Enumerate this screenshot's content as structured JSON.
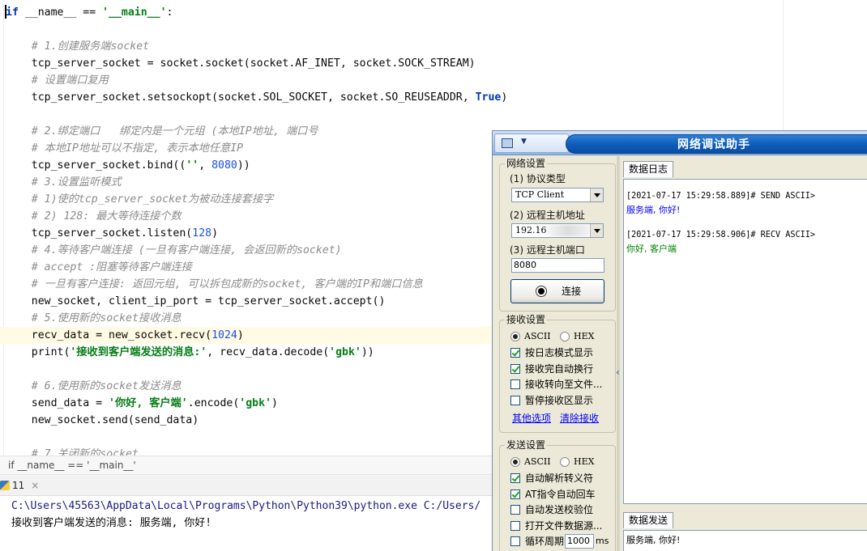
{
  "editor": {
    "lines": [
      [
        {
          "t": "if",
          "c": "c-kw"
        },
        {
          "t": " __name__ == ",
          "c": "c-text"
        },
        {
          "t": "'__main__'",
          "c": "c-string"
        },
        {
          "t": ":",
          "c": "c-text"
        }
      ],
      [],
      [
        {
          "t": "    # 1.创建服务端socket",
          "c": "c-comment"
        }
      ],
      [
        {
          "t": "    tcp_server_socket = socket.socket(socket.AF_INET, socket.SOCK_STREAM)",
          "c": "c-text"
        }
      ],
      [
        {
          "t": "    # 设置端口复用",
          "c": "c-comment"
        }
      ],
      [
        {
          "t": "    tcp_server_socket.setsockopt(socket.SOL_SOCKET, socket.SO_REUSEADDR, ",
          "c": "c-text"
        },
        {
          "t": "True",
          "c": "c-kw"
        },
        {
          "t": ")",
          "c": "c-text"
        }
      ],
      [],
      [
        {
          "t": "    # 2.绑定端口   绑定内是一个元组 (本地IP地址, 端口号",
          "c": "c-comment"
        }
      ],
      [
        {
          "t": "    # 本地IP地址可以不指定, 表示本地任意IP",
          "c": "c-comment"
        }
      ],
      [
        {
          "t": "    tcp_server_socket.bind((",
          "c": "c-text"
        },
        {
          "t": "''",
          "c": "c-string"
        },
        {
          "t": ", ",
          "c": "c-text"
        },
        {
          "t": "8080",
          "c": "c-number"
        },
        {
          "t": "))",
          "c": "c-text"
        }
      ],
      [
        {
          "t": "    # 3.设置监听模式",
          "c": "c-comment"
        }
      ],
      [
        {
          "t": "    # 1)使的tcp_server_socket为被动连接套接字",
          "c": "c-comment"
        }
      ],
      [
        {
          "t": "    # 2) 128: 最大等待连接个数",
          "c": "c-comment"
        }
      ],
      [
        {
          "t": "    tcp_server_socket.listen(",
          "c": "c-text"
        },
        {
          "t": "128",
          "c": "c-number"
        },
        {
          "t": ")",
          "c": "c-text"
        }
      ],
      [
        {
          "t": "    # 4.等待客户端连接 (一旦有客户端连接, 会返回新的socket)",
          "c": "c-comment"
        }
      ],
      [
        {
          "t": "    # accept :阻塞等待客户端连接",
          "c": "c-comment"
        }
      ],
      [
        {
          "t": "    # 一旦有客户连接: 返回元组, 可以拆包成新的socket, 客户端的IP和端口信息",
          "c": "c-comment"
        }
      ],
      [
        {
          "t": "    new_socket, client_ip_port = tcp_server_socket.accept()",
          "c": "c-text"
        }
      ],
      [
        {
          "t": "    # 5.使用新的socket接收消息",
          "c": "c-comment"
        }
      ],
      [
        {
          "t": "    recv_data = new_socket.recv(",
          "c": "c-text"
        },
        {
          "t": "1024",
          "c": "c-number"
        },
        {
          "t": ")",
          "c": "c-text"
        }
      ],
      [
        {
          "t": "    print(",
          "c": "c-text"
        },
        {
          "t": "'接收到客户端发送的消息:'",
          "c": "c-string"
        },
        {
          "t": ", recv_data.decode(",
          "c": "c-text"
        },
        {
          "t": "'gbk'",
          "c": "c-string"
        },
        {
          "t": "))",
          "c": "c-text"
        }
      ],
      [],
      [
        {
          "t": "    # 6.使用新的socket发送消息",
          "c": "c-comment"
        }
      ],
      [
        {
          "t": "    send_data = ",
          "c": "c-text"
        },
        {
          "t": "'你好, 客户端'",
          "c": "c-string"
        },
        {
          "t": ".encode(",
          "c": "c-text"
        },
        {
          "t": "'gbk'",
          "c": "c-string"
        },
        {
          "t": ")",
          "c": "c-text"
        }
      ],
      [
        {
          "t": "    new_socket.send(send_data)",
          "c": "c-text"
        }
      ],
      [],
      [
        {
          "t": "    # 7.关闭新的socket",
          "c": "c-comment"
        }
      ]
    ],
    "highlighted_line": 19
  },
  "breadcrumb": "if __name__ == '__main__'",
  "run": {
    "tab_label": "11",
    "close_glyph": "×",
    "console": [
      "C:\\Users\\45563\\AppData\\Local\\Programs\\Python\\Python39\\python.exe C:/Users/",
      "接收到客户端发送的消息: 服务端, 你好!"
    ]
  },
  "netassist": {
    "title": "网络调试助手",
    "sysmenu_arrow": "▼",
    "net_settings": {
      "group": "网络设置",
      "protocol_label": "(1) 协议类型",
      "protocol_value": "TCP Client",
      "host_label": "(2) 远程主机地址",
      "host_value": "192.16",
      "port_label": "(3) 远程主机端口",
      "port_value": "8080",
      "connect_label": "连接"
    },
    "recv_settings": {
      "group": "接收设置",
      "ascii": "ASCII",
      "hex": "HEX",
      "options": [
        {
          "label": "按日志模式显示",
          "checked": true
        },
        {
          "label": "接收完自动换行",
          "checked": true
        },
        {
          "label": "接收转向至文件...",
          "checked": false
        },
        {
          "label": "暂停接收区显示",
          "checked": false
        }
      ],
      "link_more": "其他选项",
      "link_clear": "清除接收"
    },
    "send_settings": {
      "group": "发送设置",
      "ascii": "ASCII",
      "hex": "HEX",
      "options": [
        {
          "label": "自动解析转义符",
          "checked": true
        },
        {
          "label": "AT指令自动回车",
          "checked": true
        },
        {
          "label": "自动发送校验位",
          "checked": false
        },
        {
          "label": "打开文件数据源...",
          "checked": false
        }
      ],
      "loop_label": "循环周期",
      "loop_value": "1000",
      "loop_unit": "ms"
    },
    "splitter_mark": "‹",
    "log_tab": "数据日志",
    "send_tab": "数据发送",
    "log": [
      {
        "meta": "[2021-07-17 15:29:58.889]# SEND ASCII>",
        "msg": "服务端, 你好!",
        "kind": "send"
      },
      {
        "meta": "[2021-07-17 15:29:58.906]# RECV ASCII>",
        "msg": "你好, 客户端",
        "kind": "recv"
      }
    ],
    "send_text": "服务端, 你好!"
  }
}
